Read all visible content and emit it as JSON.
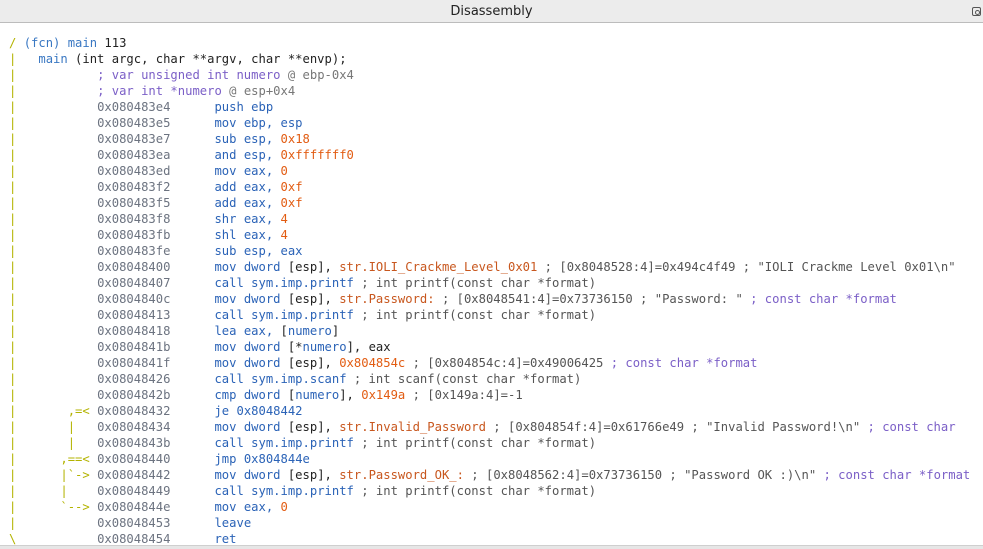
{
  "window": {
    "title": "Disassembly"
  },
  "lines": [
    {
      "segs": [
        {
          "t": "/ ",
          "c": "y"
        },
        {
          "t": "(fcn) main ",
          "c": "fcn"
        },
        {
          "t": "113",
          "c": ""
        }
      ]
    },
    {
      "segs": [
        {
          "t": "|   ",
          "c": "y"
        },
        {
          "t": "main ",
          "c": "fcn"
        },
        {
          "t": "(int argc, char **argv, char **envp);",
          "c": ""
        }
      ]
    },
    {
      "segs": [
        {
          "t": "|           ",
          "c": "y"
        },
        {
          "t": "; var unsigned int numero ",
          "c": "com"
        },
        {
          "t": "@ ebp-0x4",
          "c": "gray"
        }
      ]
    },
    {
      "segs": [
        {
          "t": "|           ",
          "c": "y"
        },
        {
          "t": "; var int *numero ",
          "c": "com"
        },
        {
          "t": "@ esp+0x4",
          "c": "gray"
        }
      ]
    },
    {
      "segs": [
        {
          "t": "|           ",
          "c": "y"
        },
        {
          "t": "0x080483e4",
          "c": "addr"
        },
        {
          "t": "      ",
          "c": ""
        },
        {
          "t": "push ebp",
          "c": "blue"
        }
      ]
    },
    {
      "segs": [
        {
          "t": "|           ",
          "c": "y"
        },
        {
          "t": "0x080483e5",
          "c": "addr"
        },
        {
          "t": "      ",
          "c": ""
        },
        {
          "t": "mov ebp, esp",
          "c": "blue"
        }
      ]
    },
    {
      "segs": [
        {
          "t": "|           ",
          "c": "y"
        },
        {
          "t": "0x080483e7",
          "c": "addr"
        },
        {
          "t": "      ",
          "c": ""
        },
        {
          "t": "sub esp, ",
          "c": "blue"
        },
        {
          "t": "0x18",
          "c": "num"
        }
      ]
    },
    {
      "segs": [
        {
          "t": "|           ",
          "c": "y"
        },
        {
          "t": "0x080483ea",
          "c": "addr"
        },
        {
          "t": "      ",
          "c": ""
        },
        {
          "t": "and esp, ",
          "c": "blue"
        },
        {
          "t": "0xfffffff0",
          "c": "num"
        }
      ]
    },
    {
      "segs": [
        {
          "t": "|           ",
          "c": "y"
        },
        {
          "t": "0x080483ed",
          "c": "addr"
        },
        {
          "t": "      ",
          "c": ""
        },
        {
          "t": "mov eax, ",
          "c": "blue"
        },
        {
          "t": "0",
          "c": "num"
        }
      ]
    },
    {
      "segs": [
        {
          "t": "|           ",
          "c": "y"
        },
        {
          "t": "0x080483f2",
          "c": "addr"
        },
        {
          "t": "      ",
          "c": ""
        },
        {
          "t": "add eax, ",
          "c": "blue"
        },
        {
          "t": "0xf",
          "c": "num"
        }
      ]
    },
    {
      "segs": [
        {
          "t": "|           ",
          "c": "y"
        },
        {
          "t": "0x080483f5",
          "c": "addr"
        },
        {
          "t": "      ",
          "c": ""
        },
        {
          "t": "add eax, ",
          "c": "blue"
        },
        {
          "t": "0xf",
          "c": "num"
        }
      ]
    },
    {
      "segs": [
        {
          "t": "|           ",
          "c": "y"
        },
        {
          "t": "0x080483f8",
          "c": "addr"
        },
        {
          "t": "      ",
          "c": ""
        },
        {
          "t": "shr eax, ",
          "c": "blue"
        },
        {
          "t": "4",
          "c": "num"
        }
      ]
    },
    {
      "segs": [
        {
          "t": "|           ",
          "c": "y"
        },
        {
          "t": "0x080483fb",
          "c": "addr"
        },
        {
          "t": "      ",
          "c": ""
        },
        {
          "t": "shl eax, ",
          "c": "blue"
        },
        {
          "t": "4",
          "c": "num"
        }
      ]
    },
    {
      "segs": [
        {
          "t": "|           ",
          "c": "y"
        },
        {
          "t": "0x080483fe",
          "c": "addr"
        },
        {
          "t": "      ",
          "c": ""
        },
        {
          "t": "sub esp, eax",
          "c": "blue"
        }
      ]
    },
    {
      "segs": [
        {
          "t": "|           ",
          "c": "y"
        },
        {
          "t": "0x08048400",
          "c": "addr"
        },
        {
          "t": "      ",
          "c": ""
        },
        {
          "t": "mov dword ",
          "c": "blue"
        },
        {
          "t": "[esp], ",
          "c": ""
        },
        {
          "t": "str.IOLI_Crackme_Level_0x01",
          "c": "str"
        },
        {
          "t": " ; [0x8048528:4]=0x494c4f49 ; \"IOLI Crackme Level 0x01\\n\"",
          "c": "cmt"
        }
      ]
    },
    {
      "segs": [
        {
          "t": "|           ",
          "c": "y"
        },
        {
          "t": "0x08048407",
          "c": "addr"
        },
        {
          "t": "      ",
          "c": ""
        },
        {
          "t": "call sym.imp.printf",
          "c": "blue"
        },
        {
          "t": " ; int printf(const char *format)",
          "c": "cmt"
        }
      ]
    },
    {
      "segs": [
        {
          "t": "|           ",
          "c": "y"
        },
        {
          "t": "0x0804840c",
          "c": "addr"
        },
        {
          "t": "      ",
          "c": ""
        },
        {
          "t": "mov dword ",
          "c": "blue"
        },
        {
          "t": "[esp], ",
          "c": ""
        },
        {
          "t": "str.Password:",
          "c": "str"
        },
        {
          "t": " ; [0x8048541:4]=0x73736150 ; \"Password: \"",
          "c": "cmt"
        },
        {
          "t": " ; const char *format",
          "c": "ptr"
        }
      ]
    },
    {
      "segs": [
        {
          "t": "|           ",
          "c": "y"
        },
        {
          "t": "0x08048413",
          "c": "addr"
        },
        {
          "t": "      ",
          "c": ""
        },
        {
          "t": "call sym.imp.printf",
          "c": "blue"
        },
        {
          "t": " ; int printf(const char *format)",
          "c": "cmt"
        }
      ]
    },
    {
      "segs": [
        {
          "t": "|           ",
          "c": "y"
        },
        {
          "t": "0x08048418",
          "c": "addr"
        },
        {
          "t": "      ",
          "c": ""
        },
        {
          "t": "lea eax, ",
          "c": "blue"
        },
        {
          "t": "[",
          "c": ""
        },
        {
          "t": "numero",
          "c": "blue"
        },
        {
          "t": "]",
          "c": ""
        }
      ]
    },
    {
      "segs": [
        {
          "t": "|           ",
          "c": "y"
        },
        {
          "t": "0x0804841b",
          "c": "addr"
        },
        {
          "t": "      ",
          "c": ""
        },
        {
          "t": "mov dword ",
          "c": "blue"
        },
        {
          "t": "[*",
          "c": ""
        },
        {
          "t": "numero",
          "c": "blue"
        },
        {
          "t": "], eax",
          "c": ""
        }
      ]
    },
    {
      "segs": [
        {
          "t": "|           ",
          "c": "y"
        },
        {
          "t": "0x0804841f",
          "c": "addr"
        },
        {
          "t": "      ",
          "c": ""
        },
        {
          "t": "mov dword ",
          "c": "blue"
        },
        {
          "t": "[esp], ",
          "c": ""
        },
        {
          "t": "0x804854c",
          "c": "num"
        },
        {
          "t": " ; [0x804854c:4]=0x49006425",
          "c": "cmt"
        },
        {
          "t": " ; const char *format",
          "c": "ptr"
        }
      ]
    },
    {
      "segs": [
        {
          "t": "|           ",
          "c": "y"
        },
        {
          "t": "0x08048426",
          "c": "addr"
        },
        {
          "t": "      ",
          "c": ""
        },
        {
          "t": "call sym.imp.scanf",
          "c": "blue"
        },
        {
          "t": " ; int scanf(const char *format)",
          "c": "cmt"
        }
      ]
    },
    {
      "segs": [
        {
          "t": "|           ",
          "c": "y"
        },
        {
          "t": "0x0804842b",
          "c": "addr"
        },
        {
          "t": "      ",
          "c": ""
        },
        {
          "t": "cmp dword ",
          "c": "blue"
        },
        {
          "t": "[",
          "c": ""
        },
        {
          "t": "numero",
          "c": "blue"
        },
        {
          "t": "], ",
          "c": ""
        },
        {
          "t": "0x149a",
          "c": "num"
        },
        {
          "t": " ; [0x149a:4]=-1",
          "c": "cmt"
        }
      ]
    },
    {
      "segs": [
        {
          "t": "|       ,=< ",
          "c": "y"
        },
        {
          "t": "0x08048432",
          "c": "addr"
        },
        {
          "t": "      ",
          "c": ""
        },
        {
          "t": "je ",
          "c": "blue"
        },
        {
          "t": "0x8048442",
          "c": "blue"
        }
      ]
    },
    {
      "segs": [
        {
          "t": "|       |   ",
          "c": "y"
        },
        {
          "t": "0x08048434",
          "c": "addr"
        },
        {
          "t": "      ",
          "c": ""
        },
        {
          "t": "mov dword ",
          "c": "blue"
        },
        {
          "t": "[esp], ",
          "c": ""
        },
        {
          "t": "str.Invalid_Password",
          "c": "str"
        },
        {
          "t": " ; [0x804854f:4]=0x61766e49 ; \"Invalid Password!\\n\"",
          "c": "cmt"
        },
        {
          "t": " ; const char",
          "c": "ptr"
        }
      ]
    },
    {
      "segs": [
        {
          "t": "|       |   ",
          "c": "y"
        },
        {
          "t": "0x0804843b",
          "c": "addr"
        },
        {
          "t": "      ",
          "c": ""
        },
        {
          "t": "call sym.imp.printf",
          "c": "blue"
        },
        {
          "t": " ; int printf(const char *format)",
          "c": "cmt"
        }
      ]
    },
    {
      "segs": [
        {
          "t": "|      ,==< ",
          "c": "y"
        },
        {
          "t": "0x08048440",
          "c": "addr"
        },
        {
          "t": "      ",
          "c": ""
        },
        {
          "t": "jmp ",
          "c": "blue"
        },
        {
          "t": "0x804844e",
          "c": "blue"
        }
      ]
    },
    {
      "segs": [
        {
          "t": "|      |`-> ",
          "c": "y"
        },
        {
          "t": "0x08048442",
          "c": "addr"
        },
        {
          "t": "      ",
          "c": ""
        },
        {
          "t": "mov dword ",
          "c": "blue"
        },
        {
          "t": "[esp], ",
          "c": ""
        },
        {
          "t": "str.Password_OK_:",
          "c": "str"
        },
        {
          "t": " ; [0x8048562:4]=0x73736150 ; \"Password OK :)\\n\"",
          "c": "cmt"
        },
        {
          "t": " ; const char *format",
          "c": "ptr"
        }
      ]
    },
    {
      "segs": [
        {
          "t": "|      |    ",
          "c": "y"
        },
        {
          "t": "0x08048449",
          "c": "addr"
        },
        {
          "t": "      ",
          "c": ""
        },
        {
          "t": "call sym.imp.printf",
          "c": "blue"
        },
        {
          "t": " ; int printf(const char *format)",
          "c": "cmt"
        }
      ]
    },
    {
      "segs": [
        {
          "t": "|      `--> ",
          "c": "y"
        },
        {
          "t": "0x0804844e",
          "c": "addr"
        },
        {
          "t": "      ",
          "c": ""
        },
        {
          "t": "mov eax, ",
          "c": "blue"
        },
        {
          "t": "0",
          "c": "num"
        }
      ]
    },
    {
      "segs": [
        {
          "t": "|           ",
          "c": "y"
        },
        {
          "t": "0x08048453",
          "c": "addr"
        },
        {
          "t": "      ",
          "c": ""
        },
        {
          "t": "leave",
          "c": "blue"
        }
      ]
    },
    {
      "segs": [
        {
          "t": "\\           ",
          "c": "y"
        },
        {
          "t": "0x08048454",
          "c": "addr"
        },
        {
          "t": "      ",
          "c": ""
        },
        {
          "t": "ret",
          "c": "blue"
        }
      ]
    }
  ]
}
